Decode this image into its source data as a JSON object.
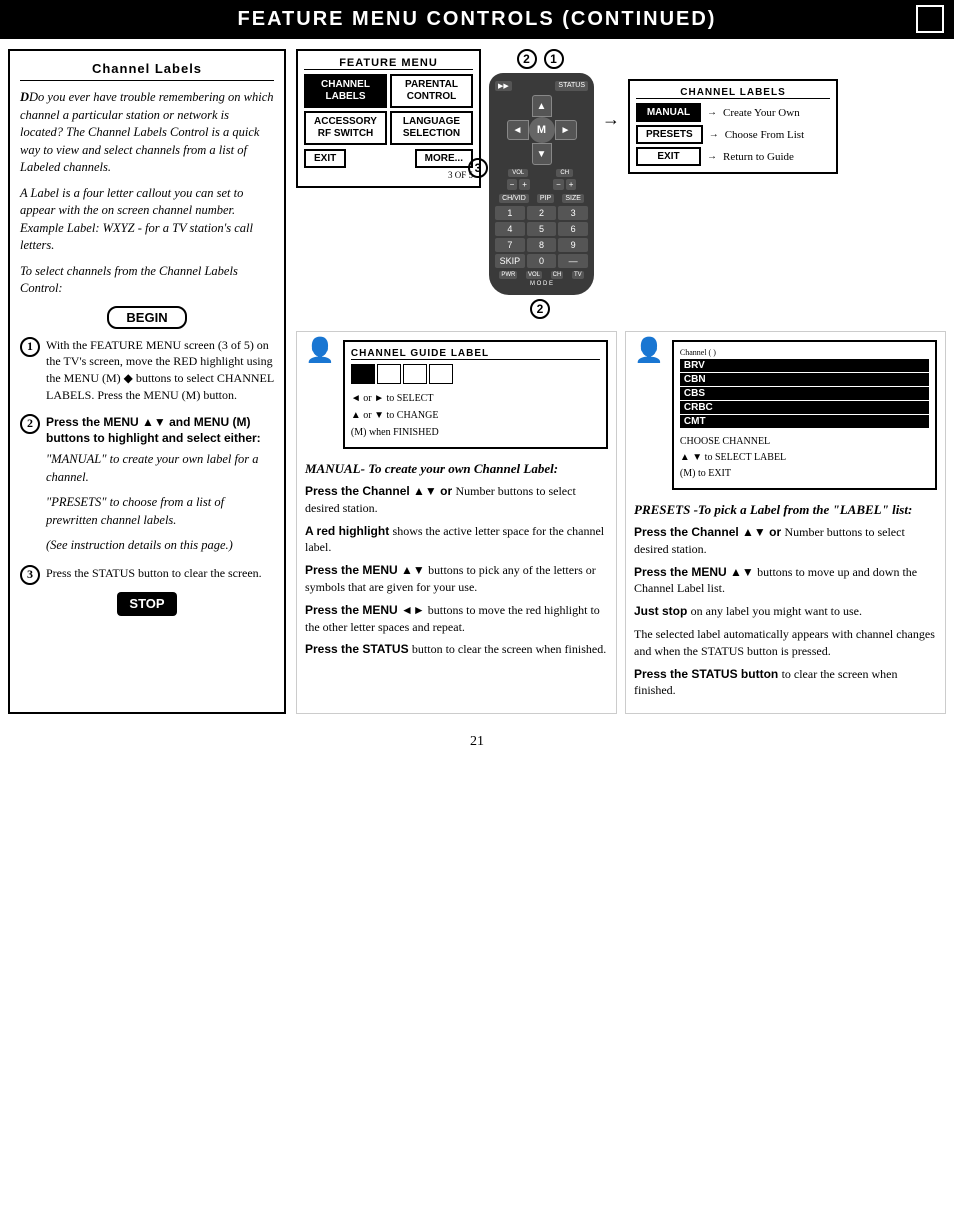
{
  "header": {
    "title": "Feature Menu Controls (Continued)",
    "box": ""
  },
  "left_panel": {
    "title": "Channel Labels",
    "intro_text": "Do you ever have trouble remembering on which channel a particular station or network is located? The Channel Labels Control is a quick way to view and select channels from a list of Labeled channels.",
    "label_text": "A Label is a four letter callout you can set to appear with the on screen channel number. Example Label: WXYZ - for a TV station's call letters.",
    "select_text": "To select channels from the Channel Labels Control:",
    "begin_label": "BEGIN",
    "step1_text": "With the FEATURE MENU screen (3 of 5) on the TV's screen, move the RED highlight using the MENU (M) ◆ buttons to select CHANNEL LABELS. Press the MENU (M) button.",
    "step2_text": "Press the MENU ▲▼ and MENU (M) buttons to highlight and select either:",
    "step2a": "\"MANUAL\" to create your own label for a channel.",
    "step2b": "\"PRESETS\" to choose from a list of prewritten channel labels.",
    "step2c": "(See instruction details on this page.)",
    "step3_text": "Press the STATUS button to clear the screen.",
    "stop_label": "STOP"
  },
  "feature_menu": {
    "title": "FEATURE MENU",
    "items": [
      {
        "label": "CHANNEL\nLABELS",
        "highlight": true
      },
      {
        "label": "PARENTAL\nCONTROL",
        "highlight": false
      },
      {
        "label": "ACCESSORY\nRF SWITCH",
        "highlight": false
      },
      {
        "label": "LANGUAGE\nSELECTION",
        "highlight": false
      }
    ],
    "exit_label": "EXIT",
    "more_label": "MORE...",
    "page_indicator": "3 OF 5"
  },
  "channel_labels_menu": {
    "title": "CHANNEL LABELS",
    "items": [
      {
        "label": "MANUAL",
        "highlight": true,
        "desc": "Create Your Own"
      },
      {
        "label": "PRESETS",
        "highlight": false,
        "desc": "Choose From List"
      },
      {
        "label": "EXIT",
        "highlight": false,
        "desc": "Return to Guide"
      }
    ]
  },
  "channel_guide": {
    "title": "CHANNEL GUIDE LABEL",
    "cells": [
      "_",
      "_",
      "_",
      "_"
    ],
    "controls": [
      "◄ or ► to SELECT",
      "▲ or ▼ to CHANGE",
      "(M) when FINISHED"
    ]
  },
  "presets_list": {
    "channels": [
      "BRV",
      "CBN",
      "CBS",
      "CRBC",
      "CMT"
    ],
    "controls": [
      "CHOOSE CHANNEL",
      "▲ ▼ to SELECT LABEL",
      "(M) to EXIT"
    ]
  },
  "manual_section": {
    "title": "MANUAL- To create your own Channel Label:",
    "steps": [
      {
        "bold": "Press the Channel ▲▼ or ",
        "text": "Number buttons to select desired station."
      },
      {
        "bold": "A red highlight ",
        "text": "shows the active letter space for the channel label."
      },
      {
        "bold": "Press the MENU ▲▼ ",
        "text": "buttons to pick any of the letters or symbols that are given for your use."
      },
      {
        "bold": "Press the MENU ◄►",
        "text": "buttons to move the red highlight to the other letter spaces and repeat."
      },
      {
        "bold": "Press the STATUS ",
        "text": "button to clear the screen when finished."
      }
    ]
  },
  "presets_section": {
    "title": "PRESETS -To pick a Label from the \"LABEL\" list:",
    "steps": [
      {
        "bold": "Press the Channel ▲▼ or ",
        "text": "Number buttons to select desired station."
      },
      {
        "bold": "Press the MENU ▲▼ ",
        "text": "buttons to move up and down the Channel Label list."
      },
      {
        "bold": "Just stop ",
        "text": "on any label you might want to use."
      },
      {
        "text": "The selected label automatically appears with channel changes and when the STATUS button is pressed."
      },
      {
        "bold": "Press the STATUS button ",
        "text": "to clear the screen when finished."
      }
    ]
  },
  "page_number": "21",
  "step_numbers": [
    "1",
    "2",
    "3"
  ],
  "icons": {
    "arrow_up": "▲",
    "arrow_down": "▼",
    "arrow_left": "◄",
    "arrow_right": "►",
    "m_button": "M"
  }
}
